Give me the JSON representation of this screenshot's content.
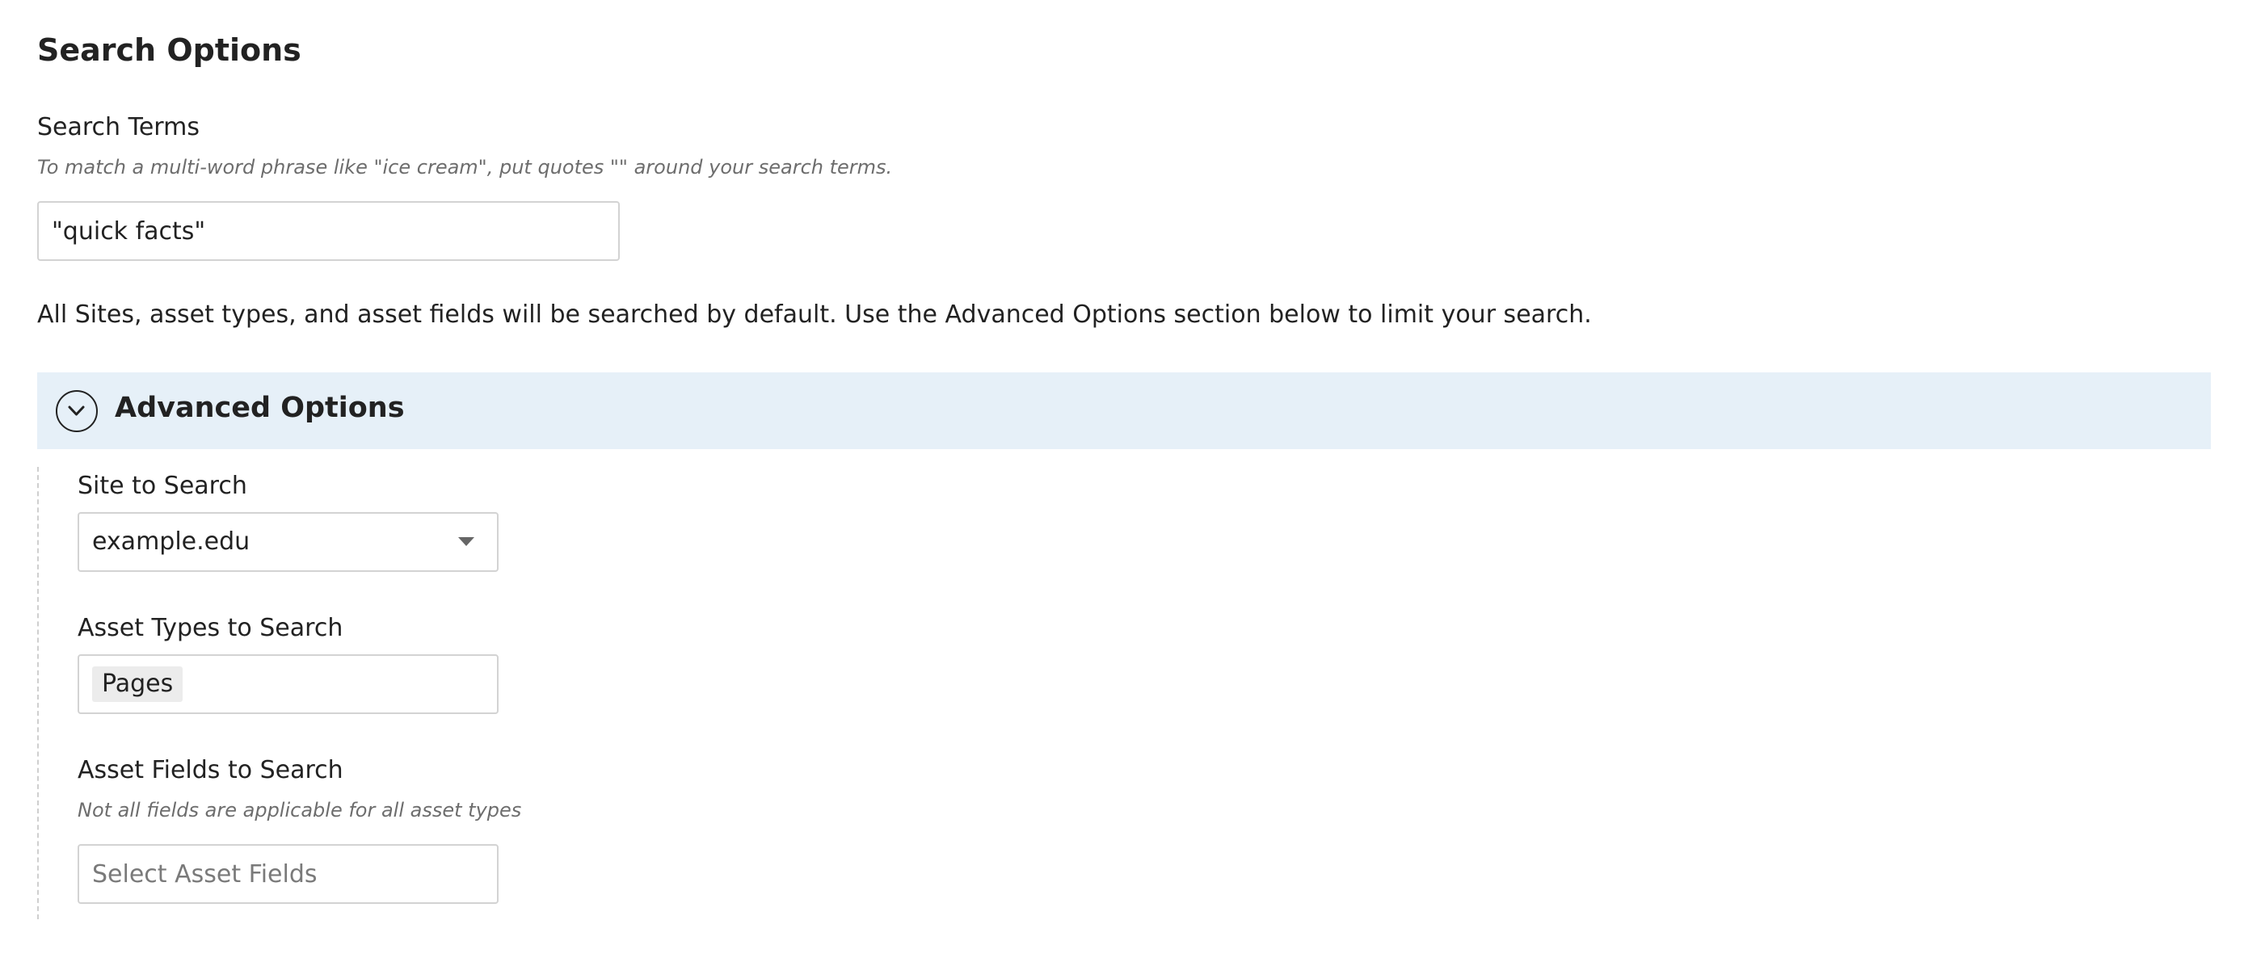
{
  "page": {
    "title": "Search Options"
  },
  "search_terms": {
    "label": "Search Terms",
    "help": "To match a multi-word phrase like \"ice cream\", put quotes \"\" around your search terms.",
    "value": "\"quick facts\""
  },
  "info": "All Sites, asset types, and asset fields will be searched by default. Use the Advanced Options section below to limit your search.",
  "advanced": {
    "title": "Advanced Options",
    "expanded": true,
    "toggle_icon": "chevron-down-icon",
    "bar_color": "#e6f0f8",
    "site": {
      "label": "Site to Search",
      "selected": "example.edu"
    },
    "asset_types": {
      "label": "Asset Types to Search",
      "tags": [
        "Pages"
      ]
    },
    "asset_fields": {
      "label": "Asset Fields to Search",
      "help": "Not all fields are applicable for all asset types",
      "placeholder": "Select Asset Fields",
      "value": ""
    }
  }
}
